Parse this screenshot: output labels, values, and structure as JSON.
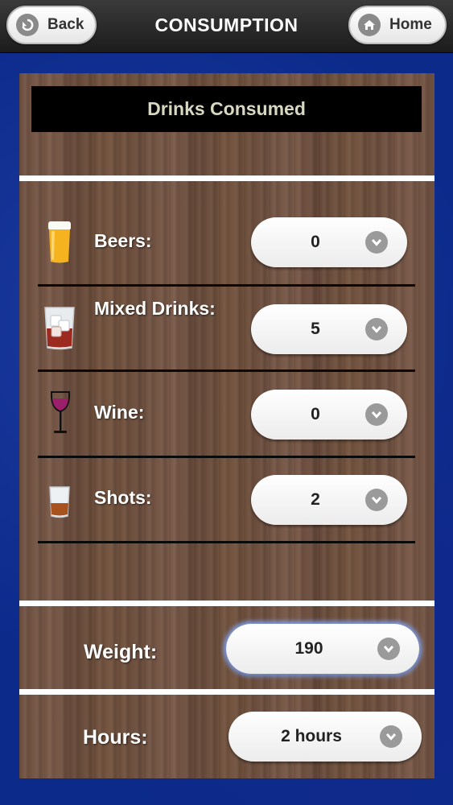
{
  "header": {
    "back_label": "Back",
    "title": "CONSUMPTION",
    "home_label": "Home"
  },
  "panel": {
    "title": "Drinks Consumed"
  },
  "drinks": [
    {
      "label": "Beers:",
      "value": "0",
      "icon": "beer-glass-icon"
    },
    {
      "label": "Mixed Drinks:",
      "value": "5",
      "icon": "mixed-drink-icon"
    },
    {
      "label": "Wine:",
      "value": "0",
      "icon": "wine-glass-icon"
    },
    {
      "label": "Shots:",
      "value": "2",
      "icon": "shot-glass-icon"
    }
  ],
  "weight": {
    "label": "Weight:",
    "value": "190"
  },
  "hours": {
    "label": "Hours:",
    "value": "2 hours"
  },
  "colors": {
    "header": "#2a2a2a",
    "background": "#0b2a8a",
    "wood": "#6f5141",
    "title_bar": "#000000"
  }
}
